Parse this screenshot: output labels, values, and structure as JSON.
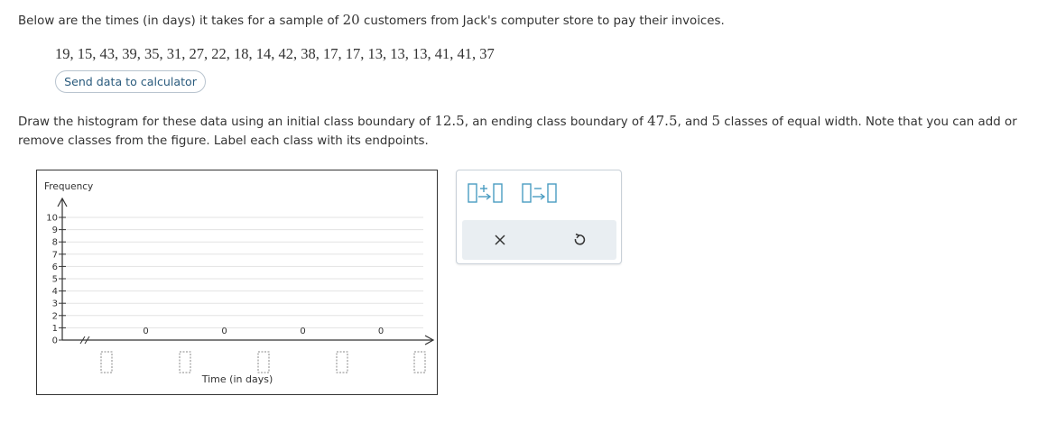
{
  "intro": {
    "part1": "Below are the times (in days) it takes for a sample of ",
    "n": "20",
    "part2": " customers from Jack's computer store to pay their invoices."
  },
  "data_values": "19, 15, 43, 39, 35, 31, 27, 22, 18, 14, 42, 38, 17, 17, 13, 13, 13, 41, 41, 37",
  "send_button_label": "Send data to calculator",
  "instructions": {
    "part1": "Draw the histogram for these data using an initial class boundary of ",
    "start": "12.5",
    "part2": ", an ending class boundary of ",
    "end": "47.5",
    "part3": ", and ",
    "classes": "5",
    "part4": " classes of equal width. Note that you can add or remove classes from the figure. Label each class with its endpoints."
  },
  "graph": {
    "y_axis_label": "Frequency",
    "x_axis_label": "Time (in days)",
    "y_ticks": [
      "0",
      "1",
      "2",
      "3",
      "4",
      "5",
      "6",
      "7",
      "8",
      "9",
      "10"
    ],
    "bar_frequencies": [
      0,
      0,
      0,
      0
    ],
    "boundary_labels": [
      "",
      "",
      "",
      "",
      ""
    ]
  },
  "chart_data": {
    "type": "bar",
    "xlabel": "Time (in days)",
    "ylabel": "Frequency",
    "ylim": [
      0,
      10
    ],
    "values": [
      0,
      0,
      0,
      0
    ],
    "grid": true
  },
  "toolbar": {
    "add_class_icon": "add-class-icon",
    "remove_class_icon": "remove-class-icon",
    "clear_icon": "x-icon",
    "undo_icon": "undo-icon"
  },
  "colors": {
    "accent": "#2a5b7d",
    "tool_icon": "#4a9cc1",
    "panel_bg": "#e9eef2"
  }
}
